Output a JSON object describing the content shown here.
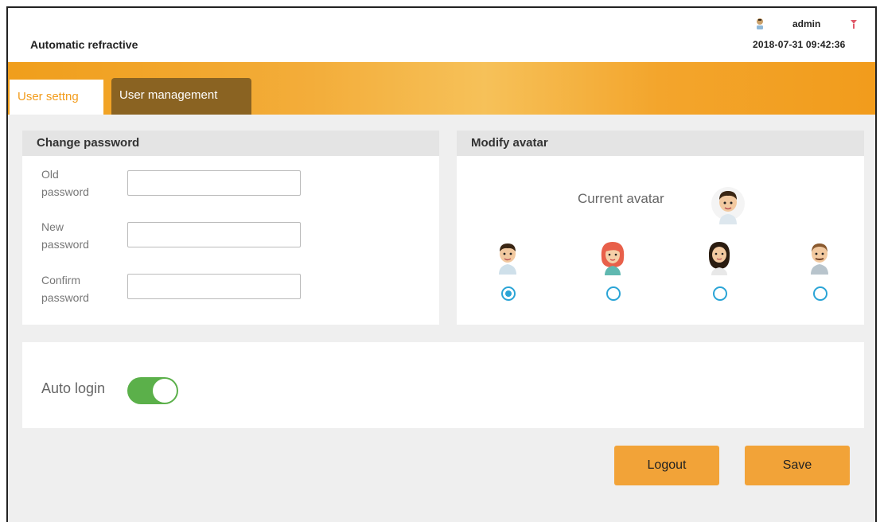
{
  "header": {
    "app_title": "Automatic refractive",
    "user_name": "admin",
    "datetime": "2018-07-31 09:42:36",
    "icons": [
      "user-icon",
      "logout-icon"
    ]
  },
  "tabs": [
    {
      "label": "User settng",
      "active": true
    },
    {
      "label": "User management",
      "active": false
    }
  ],
  "change_password": {
    "title": "Change password",
    "fields": [
      {
        "label_line1": "Old",
        "label_line2": "password",
        "value": ""
      },
      {
        "label_line1": "New",
        "label_line2": "password",
        "value": ""
      },
      {
        "label_line1": "Confirm",
        "label_line2": "password",
        "value": ""
      }
    ]
  },
  "modify_avatar": {
    "title": "Modify avatar",
    "current_label": "Current avatar",
    "options": [
      {
        "icon": "male-avatar-1-icon",
        "selected": true
      },
      {
        "icon": "female-avatar-icon",
        "selected": false
      },
      {
        "icon": "bearded-male-avatar-icon",
        "selected": false
      },
      {
        "icon": "older-male-avatar-icon",
        "selected": false
      }
    ]
  },
  "auto_login": {
    "label": "Auto login",
    "enabled": true
  },
  "buttons": {
    "logout": "Logout",
    "save": "Save"
  },
  "colors": {
    "accent": "#f29c1c",
    "tab_inactive_bg": "#8a6322",
    "toggle_on": "#5bb04a",
    "radio": "#2aa4d6",
    "button": "#f2a338"
  }
}
